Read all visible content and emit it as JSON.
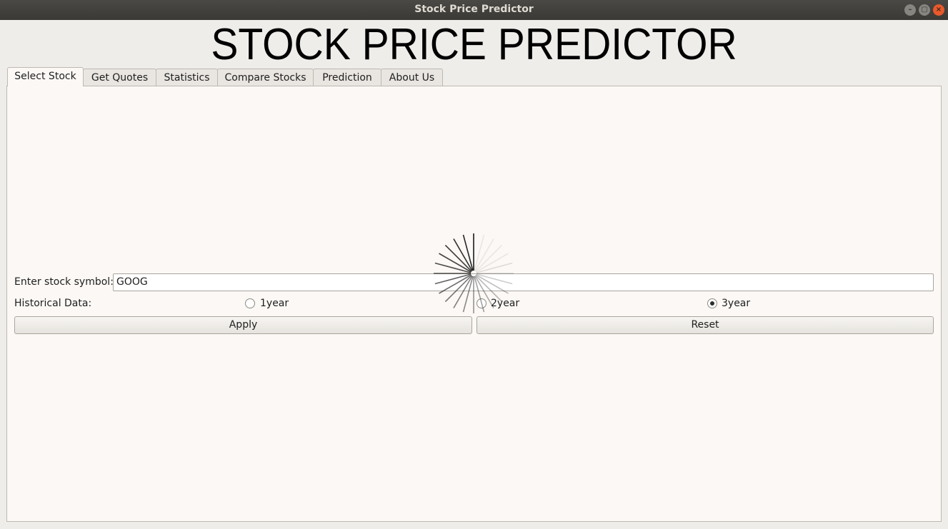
{
  "window": {
    "title": "Stock Price Predictor",
    "controls": {
      "minimize": "–",
      "maximize": "▢",
      "close": "×"
    }
  },
  "app": {
    "heading": "STOCK PRICE PREDICTOR"
  },
  "tabs": [
    {
      "label": "Select Stock",
      "active": true
    },
    {
      "label": "Get Quotes",
      "active": false
    },
    {
      "label": "Statistics",
      "active": false
    },
    {
      "label": "Compare Stocks",
      "active": false
    },
    {
      "label": "Prediction",
      "active": false
    },
    {
      "label": "About Us",
      "active": false
    }
  ],
  "form": {
    "symbol_label": "Enter stock symbol:",
    "symbol_value": "GOOG",
    "historical_label": "Historical Data:",
    "options": [
      {
        "label": "1year",
        "checked": false
      },
      {
        "label": "2year",
        "checked": false
      },
      {
        "label": "3year",
        "checked": true
      }
    ],
    "apply_label": "Apply",
    "reset_label": "Reset"
  },
  "loading": {
    "icon": "busy-spinner-icon"
  },
  "colors": {
    "titlebar": "#3f3e3a",
    "close_button": "#e9592b",
    "panel_bg": "#fbf8f5",
    "window_bg": "#efedea"
  }
}
